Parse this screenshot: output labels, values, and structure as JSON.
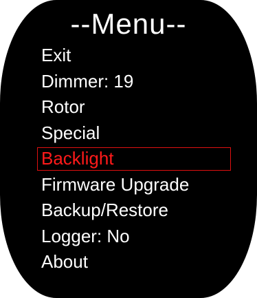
{
  "menu": {
    "title": "--Menu--",
    "items": [
      {
        "label": "Exit"
      },
      {
        "label": "Dimmer: 19"
      },
      {
        "label": "Rotor"
      },
      {
        "label": "Special"
      },
      {
        "label": "Backlight"
      },
      {
        "label": "Firmware Upgrade"
      },
      {
        "label": "Backup/Restore"
      },
      {
        "label": "Logger: No"
      },
      {
        "label": "About"
      }
    ],
    "selected_label": "Backlight"
  },
  "colors": {
    "background": "#000000",
    "text": "#ffffff",
    "selected_text": "#ff1a1a",
    "selection_border": "#e01010"
  }
}
